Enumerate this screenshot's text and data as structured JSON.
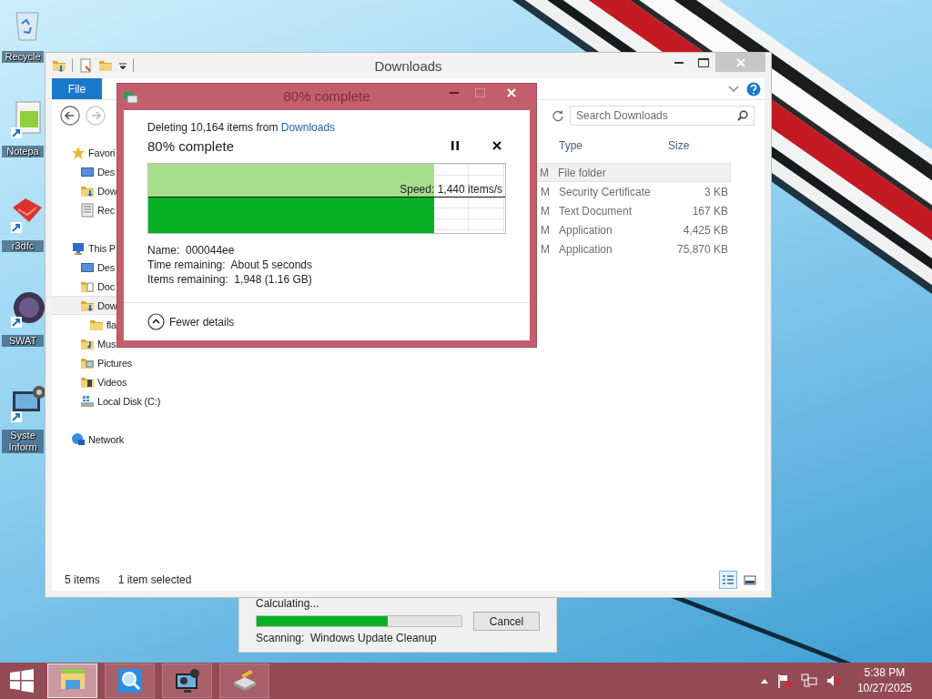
{
  "desktop_icons": [
    {
      "kind": "recycle-bin",
      "label": "Recycle"
    },
    {
      "kind": "notepad",
      "label": "Notepa"
    },
    {
      "kind": "red-app",
      "label": "r3dfc"
    },
    {
      "kind": "game",
      "label": "SWAT"
    },
    {
      "kind": "system",
      "label": "Syste Inform"
    }
  ],
  "explorer": {
    "title": "Downloads",
    "file_tab": "File",
    "search": {
      "placeholder": "Search Downloads"
    },
    "nav_pane": [
      {
        "kind": "favorites",
        "label": "Favori",
        "selected": false,
        "children": [
          {
            "kind": "desktop",
            "label": "Des",
            "selected": false
          },
          {
            "kind": "downloads",
            "label": "Dow",
            "selected": false
          },
          {
            "kind": "recent",
            "label": "Rec",
            "selected": false
          }
        ]
      },
      {
        "kind": "pc",
        "label": "This P",
        "selected": false,
        "children": [
          {
            "kind": "desktop",
            "label": "Des",
            "selected": false
          },
          {
            "kind": "documents",
            "label": "Doc",
            "selected": false
          },
          {
            "kind": "downloads",
            "label": "Dow",
            "selected": true,
            "children": [
              {
                "kind": "folder",
                "label": "fla",
                "selected": false
              }
            ]
          },
          {
            "kind": "music",
            "label": "Mus",
            "selected": false
          },
          {
            "kind": "pictures",
            "label": "Pictures",
            "selected": false
          },
          {
            "kind": "videos",
            "label": "Videos",
            "selected": false
          },
          {
            "kind": "disk",
            "label": "Local Disk (C:)",
            "selected": false
          }
        ]
      },
      {
        "kind": "network",
        "label": "Network",
        "selected": false
      }
    ],
    "columns": [
      "Type",
      "Size"
    ],
    "rows": [
      {
        "date_fragment": "M",
        "type": "File folder",
        "selected": true
      },
      {
        "date_fragment": "M",
        "type": "Security Certificate",
        "size": "3 KB",
        "selected": false
      },
      {
        "date_fragment": "M",
        "type": "Text Document",
        "size": "167 KB",
        "selected": false
      },
      {
        "date_fragment": "M",
        "type": "Application",
        "size": "4,425 KB",
        "selected": false
      },
      {
        "date_fragment": "M",
        "type": "Application",
        "size": "75,870 KB",
        "selected": false
      }
    ],
    "status_bar": {
      "item_count": "5 items",
      "selection": "1 item selected"
    },
    "view_buttons": [
      {
        "kind": "details",
        "selected": true
      },
      {
        "kind": "large-icons",
        "selected": false
      }
    ]
  },
  "delete_dialog": {
    "title": "80% complete",
    "message": "Deleting 10,164 items from",
    "source_link": "Downloads",
    "heading": "80% complete",
    "level": 0.8,
    "speed": "Speed: 1,440 items/s",
    "details": [
      {
        "label": "Name:",
        "value": "000044ee"
      },
      {
        "label": "Time remaining:",
        "value": "About 5 seconds"
      },
      {
        "label": "Items remaining:",
        "value": "1,948 (1.16 GB)"
      }
    ],
    "toggle": "Fewer details"
  },
  "cleanup_dialog": {
    "status": "Calculating...",
    "level": 0.64,
    "cancel": "Cancel",
    "scanning_label": "Scanning:",
    "scanning_item": "Windows Update Cleanup"
  },
  "taskbar": {
    "apps": [
      {
        "kind": "explorer",
        "active": true
      },
      {
        "kind": "magnifier",
        "active": false
      },
      {
        "kind": "system",
        "active": false
      },
      {
        "kind": "cleanup",
        "active": false
      }
    ],
    "time": "5:38 PM",
    "date": "10/27/2025"
  }
}
